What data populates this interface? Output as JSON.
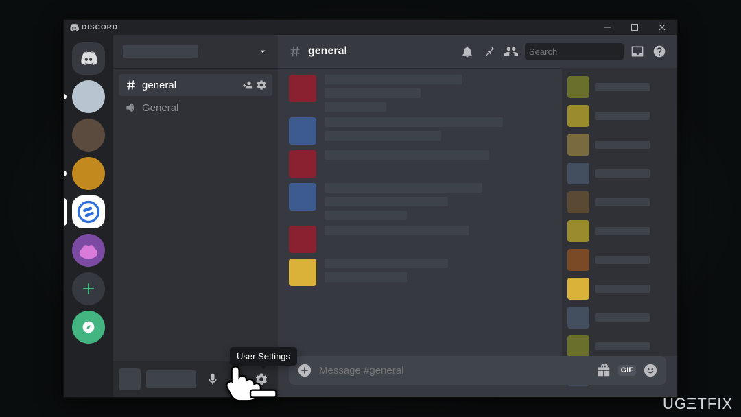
{
  "app_title": "DISCORD",
  "watermark": "UGΞTFIX",
  "channel_header": {
    "title": "general"
  },
  "text_channel": {
    "name": "general"
  },
  "voice_channel": {
    "name": "General"
  },
  "search": {
    "placeholder": "Search"
  },
  "composer": {
    "placeholder": "Message #general"
  },
  "composer_gif_label": "GIF",
  "tooltip": {
    "user_settings": "User Settings"
  },
  "message_avatars": [
    "#8a2131",
    "#3e5b8f",
    "#8a2131",
    "#3e5b8f",
    "#8a2131",
    "#dab23a"
  ],
  "member_avatars": [
    "#6b6f2c",
    "#9a8b2d",
    "#7a6a40",
    "#434f5e",
    "#5a4a33",
    "#9a8b2d",
    "#7a4a27",
    "#dab23a",
    "#434f5e",
    "#6b6f2c",
    "#434f5e"
  ],
  "server_icons": [
    {
      "bg": "#b8c4cf"
    },
    {
      "bg": "#5b4a3e"
    },
    {
      "bg": "#c28a1e"
    },
    {
      "bg": "#ffffff",
      "selected": true
    },
    {
      "bg": "#a15bd8"
    }
  ]
}
